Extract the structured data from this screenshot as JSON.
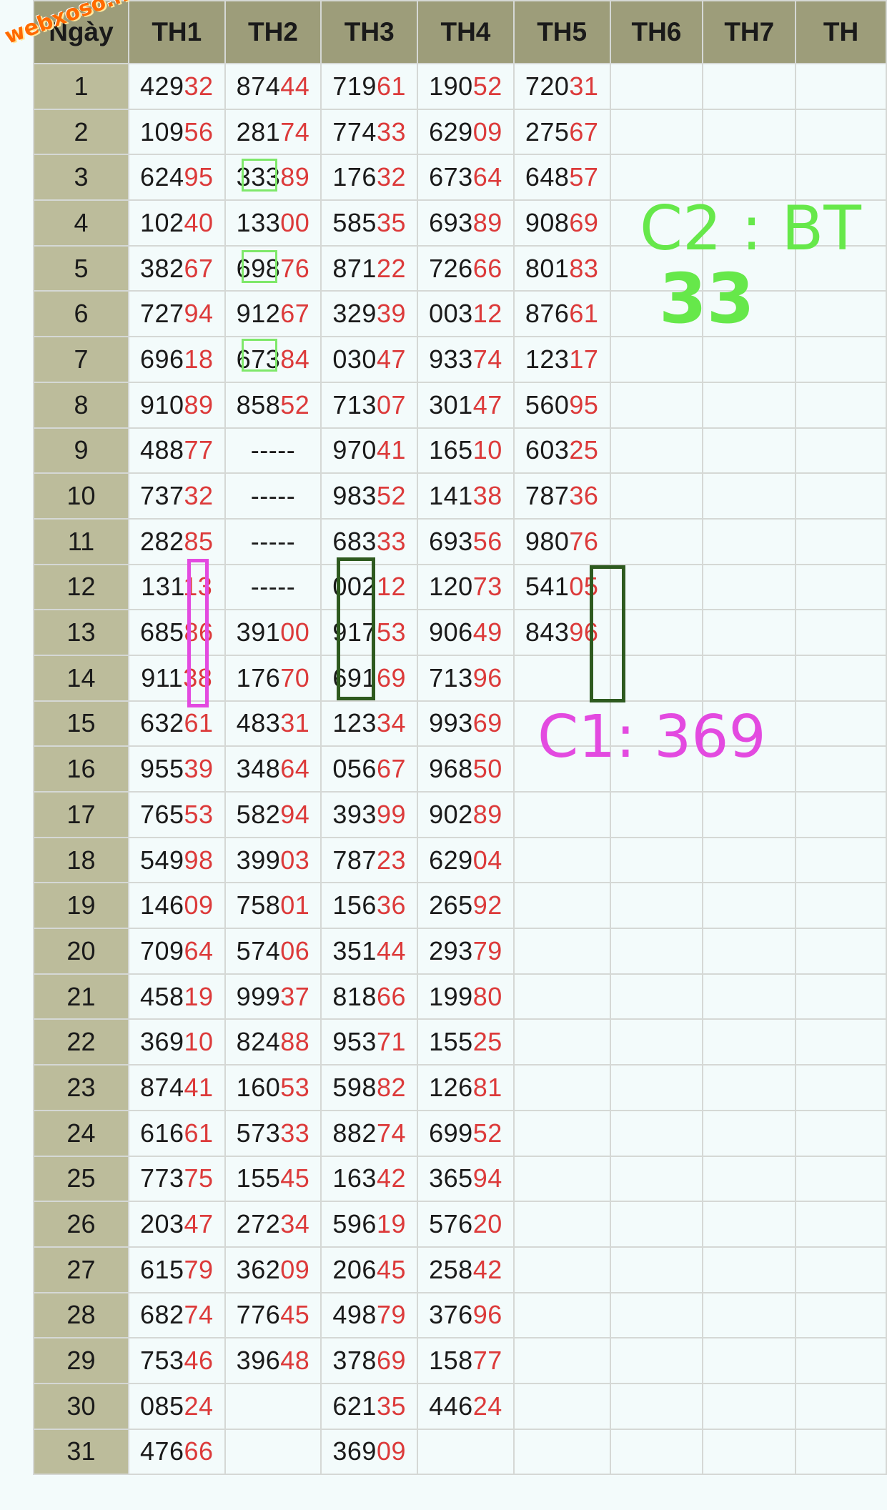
{
  "table": {
    "headers": [
      "Ngày",
      "TH1",
      "TH2",
      "TH3",
      "TH4",
      "TH5",
      "TH6",
      "TH7",
      "TH"
    ],
    "rows": [
      {
        "day": "1",
        "cells": [
          "42932",
          "87444",
          "71961",
          "19052",
          "72031"
        ]
      },
      {
        "day": "2",
        "cells": [
          "10956",
          "28174",
          "77433",
          "62909",
          "27567"
        ]
      },
      {
        "day": "3",
        "cells": [
          "62495",
          "33389",
          "17632",
          "67364",
          "64857"
        ]
      },
      {
        "day": "4",
        "cells": [
          "10240",
          "13300",
          "58535",
          "69389",
          "90869"
        ]
      },
      {
        "day": "5",
        "cells": [
          "38267",
          "69876",
          "87122",
          "72666",
          "80183"
        ]
      },
      {
        "day": "6",
        "cells": [
          "72794",
          "91267",
          "32939",
          "00312",
          "87661"
        ]
      },
      {
        "day": "7",
        "cells": [
          "69618",
          "67384",
          "03047",
          "93374",
          "12317"
        ]
      },
      {
        "day": "8",
        "cells": [
          "91089",
          "85852",
          "71307",
          "30147",
          "56095"
        ]
      },
      {
        "day": "9",
        "cells": [
          "48877",
          "-----",
          "97041",
          "16510",
          "60325"
        ]
      },
      {
        "day": "10",
        "cells": [
          "73732",
          "-----",
          "98352",
          "14138",
          "78736"
        ]
      },
      {
        "day": "11",
        "cells": [
          "28285",
          "-----",
          "68333",
          "69356",
          "98076"
        ]
      },
      {
        "day": "12",
        "cells": [
          "13113",
          "-----",
          "00212",
          "12073",
          "54105"
        ]
      },
      {
        "day": "13",
        "cells": [
          "68586",
          "39100",
          "91753",
          "90649",
          "84396"
        ]
      },
      {
        "day": "14",
        "cells": [
          "91138",
          "17670",
          "69169",
          "71396",
          ""
        ]
      },
      {
        "day": "15",
        "cells": [
          "63261",
          "48331",
          "12334",
          "99369",
          ""
        ]
      },
      {
        "day": "16",
        "cells": [
          "95539",
          "34864",
          "05667",
          "96850",
          ""
        ]
      },
      {
        "day": "17",
        "cells": [
          "76553",
          "58294",
          "39399",
          "90289",
          ""
        ]
      },
      {
        "day": "18",
        "cells": [
          "54998",
          "39903",
          "78723",
          "62904",
          ""
        ]
      },
      {
        "day": "19",
        "cells": [
          "14609",
          "75801",
          "15636",
          "26592",
          ""
        ]
      },
      {
        "day": "20",
        "cells": [
          "70964",
          "57406",
          "35144",
          "29379",
          ""
        ]
      },
      {
        "day": "21",
        "cells": [
          "45819",
          "99937",
          "81866",
          "19980",
          ""
        ]
      },
      {
        "day": "22",
        "cells": [
          "36910",
          "82488",
          "95371",
          "15525",
          ""
        ]
      },
      {
        "day": "23",
        "cells": [
          "87441",
          "16053",
          "59882",
          "12681",
          ""
        ]
      },
      {
        "day": "24",
        "cells": [
          "61661",
          "57333",
          "88274",
          "69952",
          ""
        ]
      },
      {
        "day": "25",
        "cells": [
          "77375",
          "15545",
          "16342",
          "36594",
          ""
        ]
      },
      {
        "day": "26",
        "cells": [
          "20347",
          "27234",
          "59619",
          "57620",
          ""
        ]
      },
      {
        "day": "27",
        "cells": [
          "61579",
          "36209",
          "20645",
          "25842",
          ""
        ]
      },
      {
        "day": "28",
        "cells": [
          "68274",
          "77645",
          "49879",
          "37696",
          ""
        ]
      },
      {
        "day": "29",
        "cells": [
          "75346",
          "39648",
          "37869",
          "15877",
          ""
        ]
      },
      {
        "day": "30",
        "cells": [
          "08524",
          "",
          "62135",
          "44624",
          ""
        ]
      },
      {
        "day": "31",
        "cells": [
          "47666",
          "",
          "36909",
          "",
          ""
        ]
      }
    ]
  },
  "annotations": {
    "note_c2_line1": "C2 : BT",
    "note_c2_line2": "33",
    "note_c1": "C1: 369",
    "green_note_color": "#66e84a",
    "magenta_note_color": "#e34ae0",
    "dark_box_color": "#2e5a1f"
  },
  "watermark": "webxoso.net",
  "colors": {
    "header_bg": "#9d9d7a",
    "day_col_bg": "#bcbc9b",
    "tail_digits": "#dc3a3a",
    "page_bg": "#f3fbfb"
  }
}
